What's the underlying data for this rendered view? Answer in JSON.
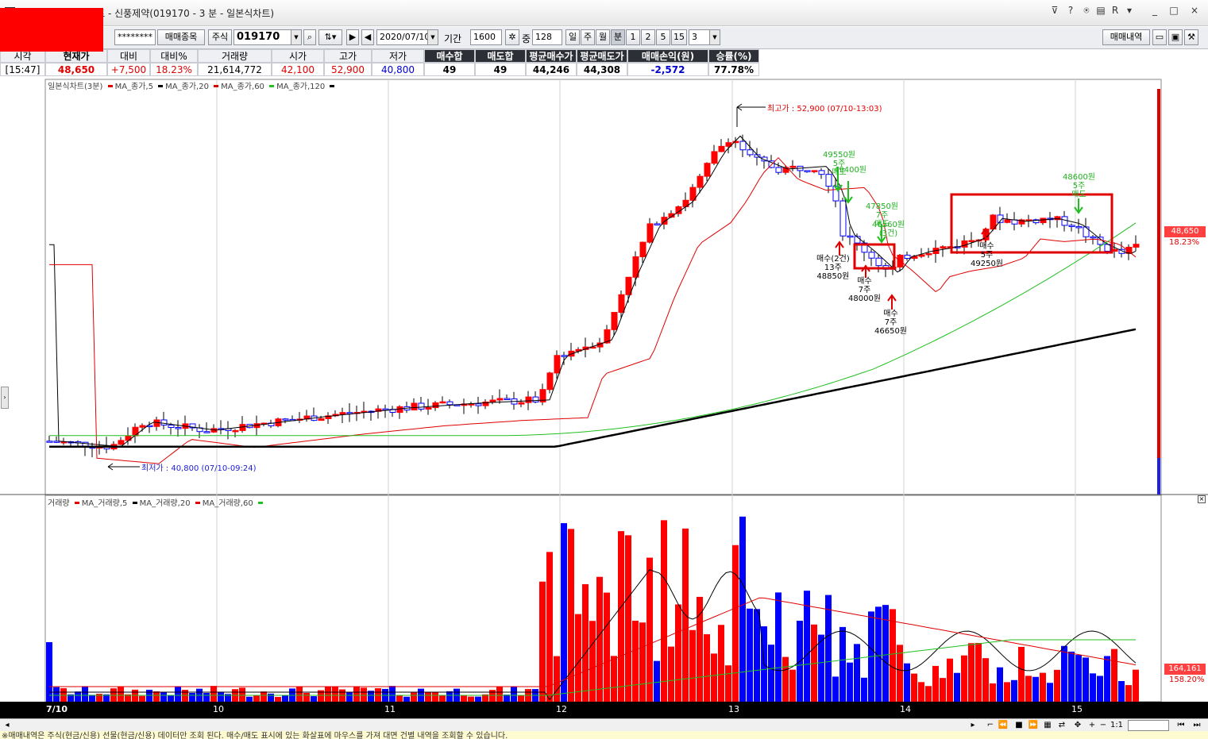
{
  "window": {
    "title": "[2450]매매복기차트 - 신풍제약(019170 - 3 분 - 일본식차트)",
    "buttons": [
      "?",
      "R",
      "_",
      "□",
      "×"
    ]
  },
  "toolbar": {
    "account_mask": "********",
    "trade_item_label": "매매종목",
    "stock_label": "주식",
    "code": "019170",
    "date": "2020/07/10",
    "period_label": "기간",
    "period_value": "1600",
    "count_label": "중",
    "count_value": "128",
    "unit_buttons": [
      "일",
      "주",
      "월",
      "분",
      "1",
      "2",
      "5",
      "15"
    ],
    "interval_value": "3",
    "trade_history_label": "매매내역"
  },
  "quote": {
    "headers": [
      "시각",
      "현재가",
      "대비",
      "대비%",
      "거래량",
      "시가",
      "고가",
      "저가",
      "매수합",
      "매도합",
      "평균매수가",
      "평균매도가",
      "매매손익(원)",
      "승률(%)"
    ],
    "values": [
      "[15:47]",
      "48,650",
      "+7,500",
      "18.23%",
      "21,614,772",
      "42,100",
      "52,900",
      "40,800",
      "49",
      "49",
      "44,246",
      "44,308",
      "-2,572",
      "77.78%"
    ]
  },
  "chart": {
    "price_legend": {
      "title": "일본식차트(3분)",
      "items": [
        {
          "label": "MA_종가,5",
          "color": "#000000"
        },
        {
          "label": "MA_종가,20",
          "color": "#e00000"
        },
        {
          "label": "MA_종가,60",
          "color": "#20c020"
        },
        {
          "label": "MA_종가,120",
          "color": "#000000"
        }
      ]
    },
    "volume_legend": {
      "title": "거래량",
      "items": [
        {
          "label": "MA_거래량,5",
          "color": "#000000"
        },
        {
          "label": "MA_거래량,20",
          "color": "#e00000"
        },
        {
          "label": "MA_거래량,60",
          "color": "#20c020"
        }
      ]
    },
    "high_label": "최고가 : 52,900 (07/10-13:03)",
    "low_label": "최저가 : 40,800 (07/10-09:24)",
    "last_price_tag": "48,650",
    "last_price_pct": "18.23%",
    "last_volume_tag": "164,161",
    "last_volume_pct": "158.20%",
    "x_ticks": [
      "7/10",
      "10",
      "11",
      "12",
      "13",
      "14",
      "15"
    ],
    "annotations": {
      "sell1": [
        "49550원",
        "5주",
        "매도"
      ],
      "sell1b": [
        "49400원"
      ],
      "sell2": [
        "47850원",
        "7주",
        "매도"
      ],
      "sell2b": [
        "46560원",
        "(3건)"
      ],
      "sell3": [
        "48600원",
        "5주",
        "매도"
      ],
      "buy1": [
        "매수(2건)",
        "13주",
        "48850원"
      ],
      "buy2": [
        "매수",
        "7주",
        "48000원"
      ],
      "buy3": [
        "매수",
        "7주",
        "46650원"
      ],
      "buy4": [
        "매수",
        "5주",
        "49250원"
      ]
    },
    "colors": {
      "up": "#ff0000",
      "down": "#0000ff"
    }
  },
  "status": {
    "text": "※매매내역은 주식(현금/신용) 선물(현금/신용) 데이터만 조회 된다. 매수/매도 표시에 있는 화살표에 마우스를 가져 대면 건별 내역을 조회할 수 있습니다."
  },
  "scroll": {
    "zoom": "1:1"
  }
}
